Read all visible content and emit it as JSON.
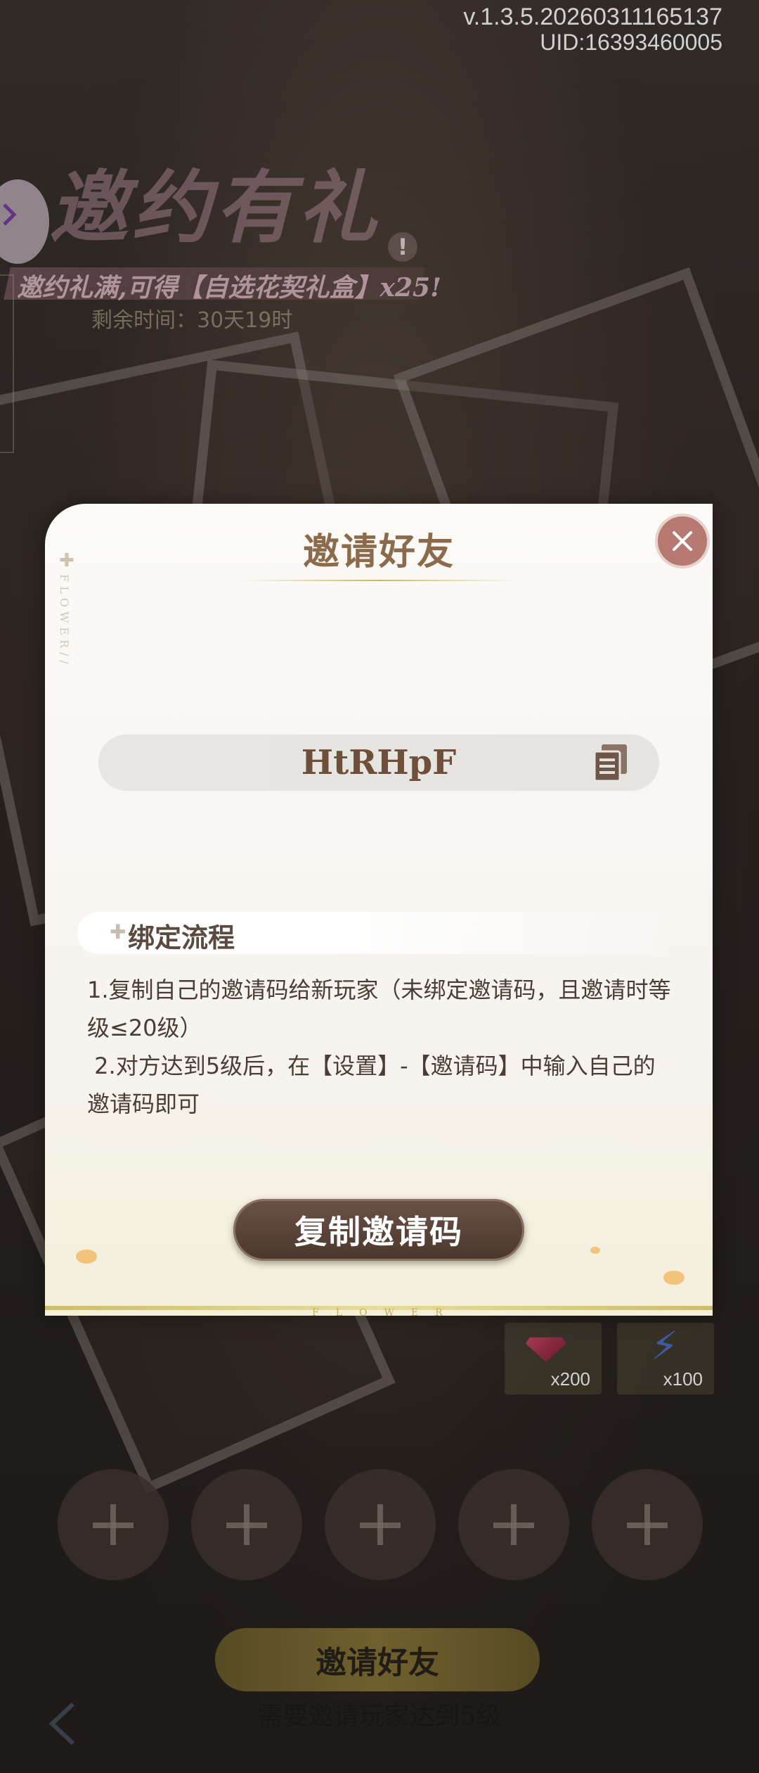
{
  "status": {
    "version": "v.1.3.5.20260311165137",
    "uid": "UID:16393460005"
  },
  "event": {
    "title": "邀约有礼",
    "alert": "!",
    "subtitle": "邀约礼满,可得【自选花契礼盒】x25!",
    "timer": "剩余时间：30天19时"
  },
  "rewards": [
    {
      "icon": "gem-icon",
      "qty": "x200"
    },
    {
      "icon": "energy-bolt-icon",
      "qty": "x100"
    }
  ],
  "slots_count": 5,
  "footer": {
    "invite_button": "邀请好友",
    "hint": "需要邀请玩家达到5级"
  },
  "modal": {
    "title": "邀请好友",
    "side_text": "FLOWER//",
    "invite_code": "HtRHpF",
    "section_title": "绑定流程",
    "instructions": [
      "1.复制自己的邀请码给新玩家（未绑定邀请码，且邀请时等级≤20级）",
      " 2.对方达到5级后，在【设置】-【邀请码】中输入自己的邀请码即可"
    ],
    "copy_button": "复制邀请码",
    "bottom_text": "FLOWER"
  },
  "colors": {
    "modal_title": "#8b6b4b",
    "close_button": "#b77a72",
    "copy_button": "#5b4438",
    "accent_gold": "#c8b66c"
  }
}
